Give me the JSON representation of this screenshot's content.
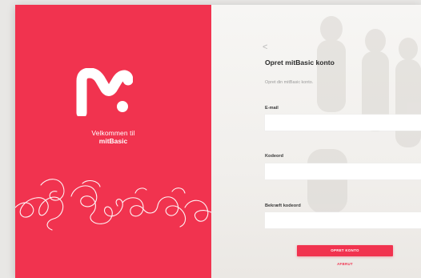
{
  "brand": {
    "welcome_line1": "Velkommen til",
    "welcome_line2": "mitBasic",
    "logo_icon": "m-logo-icon",
    "accent_color": "#f1334f"
  },
  "form": {
    "back_icon": "chevron-left-icon",
    "back_glyph": "<",
    "title": "Opret mitBasic konto",
    "subtitle": "Opret din mitBasic konto.",
    "fields": [
      {
        "label": "E-mail",
        "value": "",
        "placeholder": ""
      },
      {
        "label": "Kodeord",
        "value": "",
        "placeholder": ""
      },
      {
        "label": "Bekræft kodeord",
        "value": "",
        "placeholder": ""
      }
    ],
    "submit_label": "OPRET KONTO",
    "cancel_label": "AFBRUT"
  }
}
